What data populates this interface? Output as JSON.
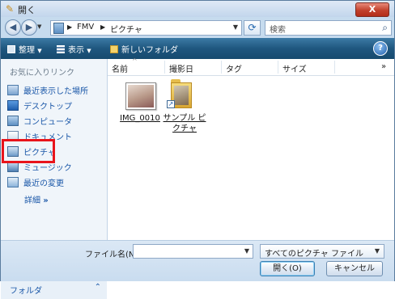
{
  "window": {
    "title": "開く",
    "close_glyph": "X"
  },
  "nav": {
    "back_glyph": "◀",
    "forward_glyph": "▶"
  },
  "address": {
    "crumbs": [
      "FMV",
      "ピクチャ"
    ],
    "separator": "▶"
  },
  "search": {
    "placeholder": "検索"
  },
  "toolbar": {
    "organize": "整理",
    "views": "表示",
    "new_folder": "新しいフォルダ",
    "help": "?"
  },
  "sidebar": {
    "header": "お気に入りリンク",
    "items": [
      {
        "label": "最近表示した場所",
        "icon": "recent-places-icon"
      },
      {
        "label": "デスクトップ",
        "icon": "desktop-icon"
      },
      {
        "label": "コンピュータ",
        "icon": "computer-icon"
      },
      {
        "label": "ドキュメント",
        "icon": "documents-icon"
      },
      {
        "label": "ピクチャ",
        "icon": "pictures-icon"
      },
      {
        "label": "ミュージック",
        "icon": "music-icon"
      },
      {
        "label": "最近の変更",
        "icon": "recently-changed-icon"
      }
    ],
    "more_label": "詳細",
    "more_glyph": "»",
    "folders_label": "フォルダ",
    "folders_glyph": "⌃"
  },
  "columns": [
    "名前",
    "撮影日",
    "タグ",
    "サイズ"
  ],
  "columns_more": "»",
  "files": [
    {
      "name": "IMG_0010",
      "kind": "image"
    },
    {
      "name_line1": "サンプル ピ",
      "name_line2": "クチャ",
      "kind": "folder-shortcut"
    }
  ],
  "footer": {
    "filename_label": "ファイル名(N):",
    "filename_value": "",
    "filetype_value": "すべてのピクチャ ファイル",
    "open_button": "開く(O)",
    "cancel_button": "キャンセル"
  },
  "colors": {
    "highlight": "#e8141b",
    "link": "#1a57a8",
    "toolbar": "#1f577f"
  }
}
